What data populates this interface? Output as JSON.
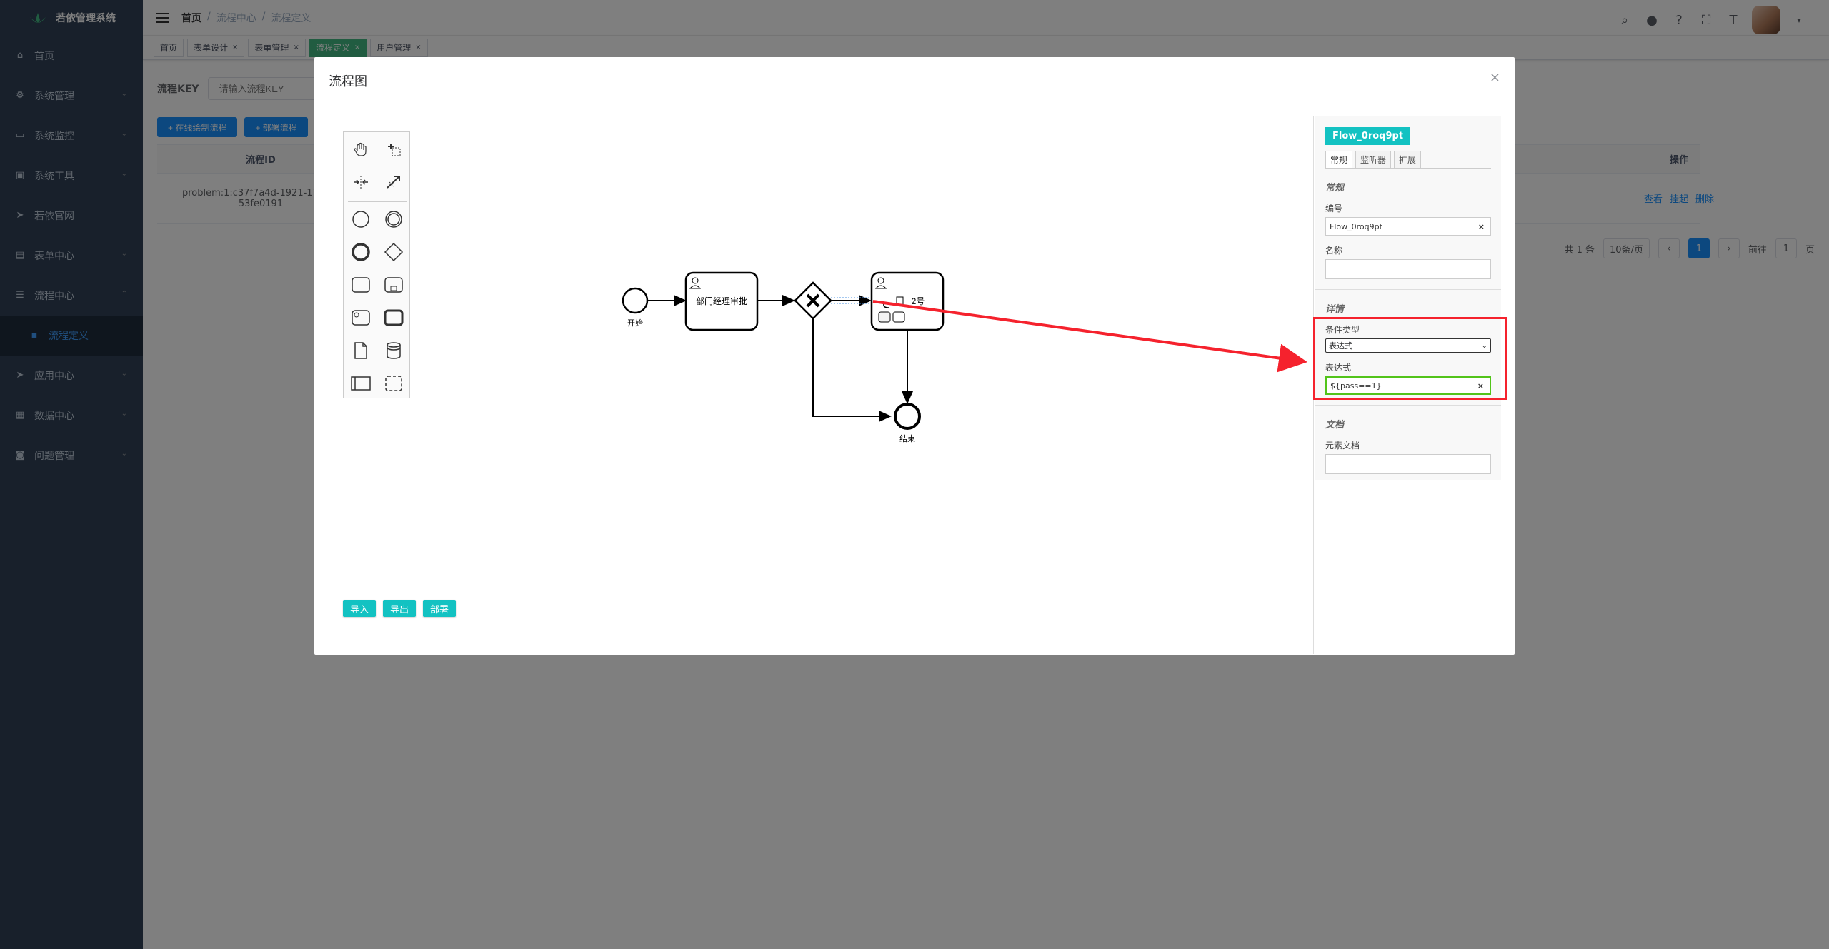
{
  "app": {
    "title": "若依管理系统"
  },
  "sidebar": {
    "items": [
      {
        "label": "首页",
        "icon": "home-icon"
      },
      {
        "label": "系统管理",
        "icon": "gear-icon"
      },
      {
        "label": "系统监控",
        "icon": "monitor-icon"
      },
      {
        "label": "系统工具",
        "icon": "tool-icon"
      },
      {
        "label": "若依官网",
        "icon": "send-icon"
      },
      {
        "label": "表单中心",
        "icon": "form-icon"
      },
      {
        "label": "流程中心",
        "icon": "flow-icon"
      },
      {
        "label": "流程定义",
        "icon": "list-icon"
      },
      {
        "label": "应用中心",
        "icon": "send-icon"
      },
      {
        "label": "数据中心",
        "icon": "data-icon"
      },
      {
        "label": "问题管理",
        "icon": "issue-icon"
      }
    ]
  },
  "breadcrumb": [
    "首页",
    "流程中心",
    "流程定义"
  ],
  "tags": [
    "首页",
    "表单设计",
    "表单管理",
    "流程定义",
    "用户管理"
  ],
  "search": {
    "label": "流程KEY",
    "placeholder": "请输入流程KEY"
  },
  "buttons": {
    "draw": "+ 在线绘制流程",
    "deploy": "+ 部署流程"
  },
  "table": {
    "header_id": "流程ID",
    "header_op": "操作",
    "row_id_line1": "problem:1:c37f7a4d-1921-11ed-b",
    "row_id_line2": "53fe0191",
    "ops": [
      "查看",
      "挂起",
      "删除"
    ]
  },
  "pagination": {
    "total": "共 1 条",
    "size": "10条/页",
    "current": "1",
    "goto": "前往",
    "goto_value": "1",
    "page_unit": "页"
  },
  "dialog": {
    "title": "流程图",
    "actions": [
      "导入",
      "导出",
      "部署"
    ]
  },
  "diagram": {
    "start": "开始",
    "task1": "部门经理审批",
    "task2": "2号",
    "end": "结束"
  },
  "panel": {
    "element_id": "Flow_0roq9pt",
    "tabs": [
      "常规",
      "监听器",
      "扩展"
    ],
    "general_title": "常规",
    "id_label": "编号",
    "id_value": "Flow_0roq9pt",
    "name_label": "名称",
    "name_value": "",
    "details_title": "详情",
    "condition_type_label": "条件类型",
    "condition_type_value": "表达式",
    "expression_label": "表达式",
    "expression_value": "${pass==1}",
    "doc_title": "文档",
    "doc_label": "元素文档",
    "doc_value": ""
  },
  "colors": {
    "sidebar": "#304156",
    "primary": "#1890ff",
    "teal": "#13c2c2",
    "highlight": "#f5222d"
  }
}
